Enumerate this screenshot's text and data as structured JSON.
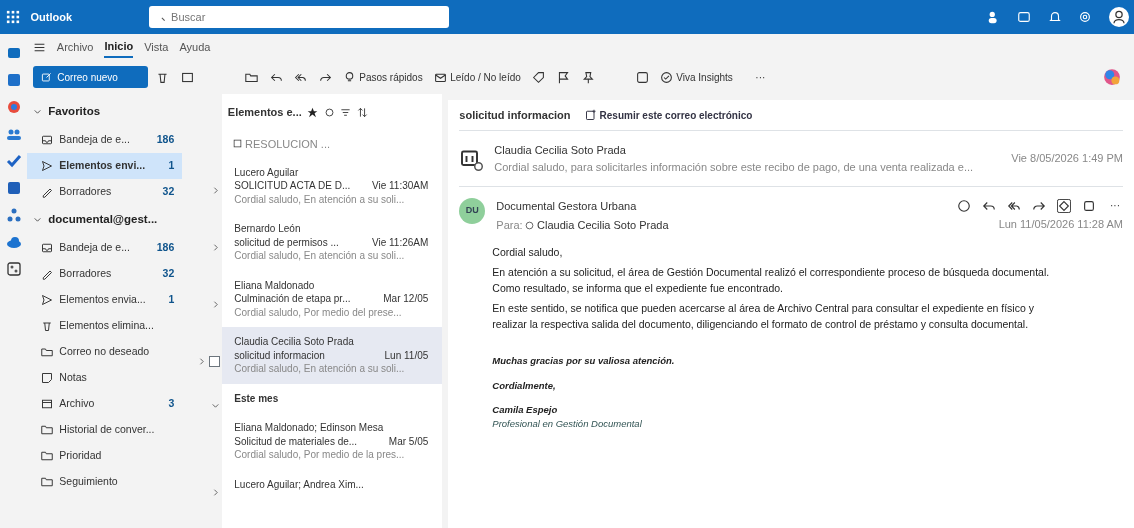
{
  "app": {
    "title": "Outlook",
    "search_placeholder": "Buscar"
  },
  "ribbon_tabs": [
    {
      "label": "Archivo",
      "selected": false
    },
    {
      "label": "Inicio",
      "selected": true
    },
    {
      "label": "Vista",
      "selected": false
    },
    {
      "label": "Ayuda",
      "selected": false
    }
  ],
  "toolbar": {
    "new_mail": "Correo nuevo",
    "quick_steps": "Pasos rápidos",
    "read_unread": "Leído / No leído",
    "insights": "Viva Insights",
    "more": "···"
  },
  "folder_sections": [
    {
      "title": "Favoritos",
      "expanded": true,
      "items": [
        {
          "label": "Bandeja de e...",
          "count": "186",
          "selected": false
        },
        {
          "label": "Elementos envi...",
          "count": "1",
          "selected": true
        },
        {
          "label": "Borradores",
          "count": "32",
          "selected": false
        }
      ]
    },
    {
      "title": "documental@gest...",
      "expanded": true,
      "items": [
        {
          "label": "Bandeja de e...",
          "count": "186",
          "selected": false
        },
        {
          "label": "Borradores",
          "count": "32",
          "selected": false
        },
        {
          "label": "Elementos envia...",
          "count": "1",
          "selected": false
        },
        {
          "label": "Elementos elimina...",
          "selected": false
        },
        {
          "label": "Correo no deseado",
          "selected": false
        },
        {
          "label": "Notas",
          "selected": false
        },
        {
          "label": "Archivo",
          "count": "3",
          "selected": false
        },
        {
          "label": "Historial de conver...",
          "selected": false
        },
        {
          "label": "Prioridad",
          "selected": false
        },
        {
          "label": "Seguimiento",
          "selected": false
        }
      ]
    }
  ],
  "message_list": {
    "title": "Elementos e...",
    "pinned": "RESOLUCION ...",
    "items": [
      {
        "kind": "message",
        "sender": "Lucero Aguilar",
        "subject": "SOLICITUD ACTA DE D...",
        "time": "Vie 11:30AM",
        "preview": "Cordial saludo, En atención a su soli...",
        "thread": true,
        "selected": false
      },
      {
        "kind": "message",
        "sender": "Bernardo León",
        "subject": "solicitud de permisos ...",
        "time": "Vie 11:26AM",
        "preview": "Cordial saludo, En atención a su soli...",
        "thread": true,
        "selected": false
      },
      {
        "kind": "message",
        "sender": "Eliana Maldonado",
        "subject": "Culminación de etapa pr...",
        "time": "Mar 12/05",
        "preview": "Cordial saludo, Por medio del prese...",
        "thread": true,
        "selected": false
      },
      {
        "kind": "message",
        "sender": "Claudia Cecilia Soto Prada",
        "subject": "solicitud informacion",
        "time": "Lun 11/05",
        "preview": "Cordial saludo, En atención a su soli...",
        "thread": true,
        "selected": true,
        "checked": false
      },
      {
        "kind": "group",
        "label": "Este mes",
        "expanded": true
      },
      {
        "kind": "message",
        "sender": "Eliana Maldonado; Edinson Mesa",
        "subject": "Solicitud de materiales de...",
        "time": "Mar 5/05",
        "preview": "Cordial saludo, Por medio de la pres...",
        "thread": false,
        "selected": false
      },
      {
        "kind": "partial",
        "sender": "Lucero Aguilar; Andrea Xim...",
        "thread": true,
        "selected": false
      }
    ]
  },
  "reading_pane": {
    "subject": "solicitud informacion",
    "summarize": "Resumir este correo electrónico",
    "collapsed_message": {
      "sender": "Claudia Cecilia Soto Prada",
      "preview": "Cordial saludo, para solicitarles información sobre este recibo de pago, de una venta realizada e...",
      "time": "Vie 8/05/2026 1:49 PM"
    },
    "open_message": {
      "initials": "DU",
      "sender": "Documental Gestora Urbana",
      "to_label": "Para:",
      "to": "Claudia Cecilia Soto Prada",
      "time": "Lun 11/05/2026 11:28 AM",
      "body": [
        "Cordial saludo,",
        "En atención a su solicitud, el área de Gestión Documental realizó el correspondiente proceso de búsqueda documental. Como resultado, se informa que el expediente fue encontrado.",
        "En este sentido, se notifica que pueden acercarse al área de Archivo Central para consultar el expediente en físico y realizar la respectiva salida del documento, diligenciando el formato de control de préstamo y consulta documental."
      ],
      "signature": [
        "Muchas gracias por su valiosa atención.",
        "Cordialmente,",
        "Camila Espejo",
        "Profesional en Gestión Documental"
      ]
    }
  }
}
